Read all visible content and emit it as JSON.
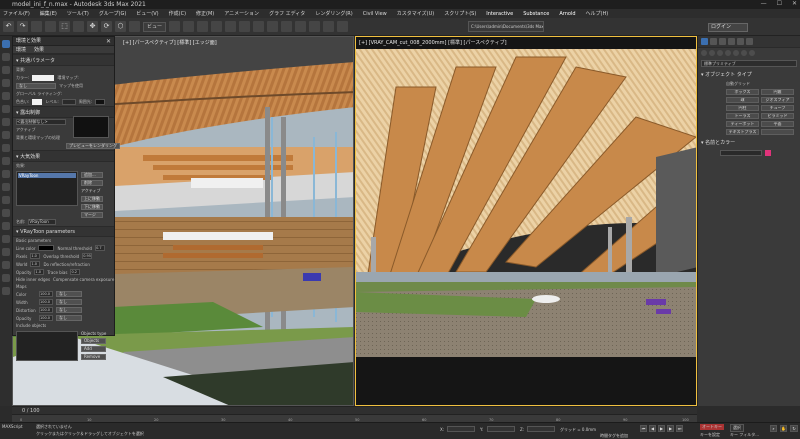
{
  "window": {
    "title": "model_ini_f_n.max - Autodesk 3ds Max 2021",
    "controls": [
      "—",
      "☐",
      "✕"
    ]
  },
  "menu": [
    "ファイル(F)",
    "編集(E)",
    "ツール(T)",
    "グループ(G)",
    "ビュー(V)",
    "作成(C)",
    "修正(M)",
    "アニメーション",
    "グラフ エディタ",
    "レンダリング(R)",
    "Civil View",
    "カスタマイズ(U)",
    "スクリプト(S)",
    "Interactive",
    "Substance",
    "Arnold",
    "ヘルプ(H)"
  ],
  "toolbar": {
    "undo": "↶",
    "redo": "↷",
    "select": "⬚",
    "move": "✥",
    "rotate": "⟳",
    "scale": "⬡",
    "view_dropdown": "ビュー",
    "path": "C:\\Users\\admin\\Documents\\3ds Max 2021",
    "user": "ログイン"
  },
  "viewports": {
    "left_label": "[+] [パースペクティブ] [標準] [エッジ面]",
    "right_label": "[+] [VRAY_CAM_cut_008_2000mm] [標準] [パースペクティブ]"
  },
  "dialog": {
    "title": "環境と効果",
    "tabs": [
      "環境",
      "効果"
    ],
    "sections": {
      "common": "共通パラメータ",
      "background": "背景:",
      "color_label": "カラー:",
      "env_map": "環境マップ:",
      "use_map": "マップを使用",
      "global_light": "グローバル ライティング:",
      "tint": "色合い:",
      "level": "レベル:",
      "level_value": "1.0",
      "ambient": "周囲光:",
      "exposure": "露出制御",
      "exposure_type": "<露出制御なし>",
      "active": "アクティブ",
      "process_bg": "背景と環境マップの処理",
      "preview": "プレビューをレンダリング",
      "atmosphere": "大気効果",
      "effects_label": "効果:",
      "effect_item": "VRayToon",
      "add": "追加...",
      "delete": "削除",
      "active2": "アクティブ",
      "move_up": "上に移動",
      "move_down": "下に移動",
      "merge": "マージ",
      "name_label": "名前:",
      "name_value": "VRayToon",
      "toon": "VRayToon parameters",
      "basic": "Basic parameters",
      "line_color": "Line color",
      "normal_threshold": "Normal threshold",
      "normal_value": "0.7",
      "pixels": "Pixels",
      "pixels_value": "1.0",
      "overlap": "Overlap threshold",
      "overlap_value": "0.95",
      "world": "World",
      "world_value": "1.0",
      "do_reflect": "Do reflection/refraction",
      "opacity": "Opacity",
      "opacity_value": "1.0",
      "trace_bias": "Trace bias",
      "trace_value": "0.2",
      "hide_inner": "Hide inner edges",
      "compensate": "Compensate camera exposure",
      "maps": "Maps",
      "color": "Color",
      "width": "Width",
      "distortion": "Distortion",
      "opacity2": "Opacity",
      "map_val": "100.0",
      "none": "なし",
      "include": "Include objects",
      "objects_type": "Objects type",
      "objects_value": "Objects",
      "add2": "Add",
      "remove": "Remove"
    }
  },
  "command_panel": {
    "dropdown": "標準プリミティブ",
    "object_type": "オブジェクト タイプ",
    "autogrid": "自動グリッド",
    "objects": [
      "ボックス",
      "円錐",
      "球",
      "ジオスフィア",
      "円柱",
      "チューブ",
      "トーラス",
      "ピラミッド",
      "ティーポット",
      "平面",
      "テキストプラス",
      ""
    ],
    "name_color": "名前とカラー"
  },
  "timeline": {
    "frame": "0 / 100"
  },
  "ruler": [
    "0",
    "10",
    "20",
    "30",
    "40",
    "50",
    "60",
    "70",
    "80",
    "90",
    "100"
  ],
  "status": {
    "selected": "選択されていません",
    "hint": "クリックまたはクリック＆ドラッグしてオブジェクトを選択",
    "maxscript": "MAXScript",
    "x": "X:",
    "y": "Y:",
    "z": "Z:",
    "grid": "グリッド = 0.0mm",
    "addtime": "時間タグを追加",
    "autokey": "オートキー",
    "selected_dd": "選択",
    "setkey": "キーを設定",
    "keyfilters": "キー フィルタ..."
  }
}
